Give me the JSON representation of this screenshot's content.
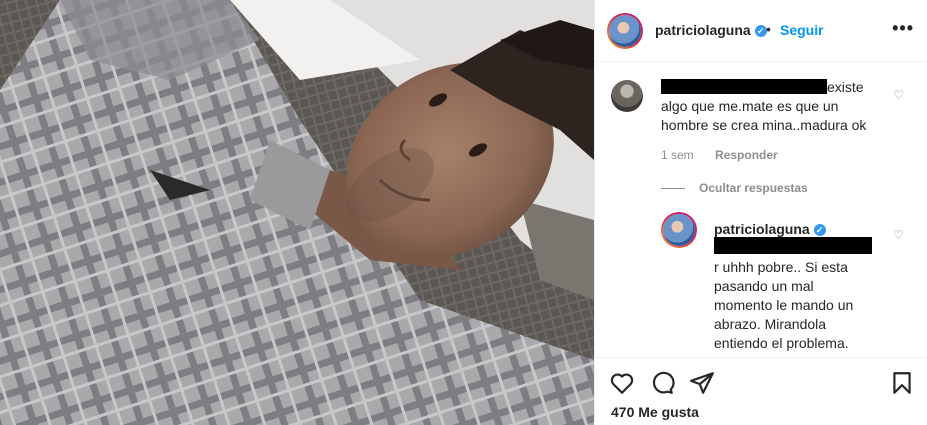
{
  "post": {
    "username": "patriciolaguna",
    "follow_label": "Seguir",
    "dot": "•",
    "more_label": "•••"
  },
  "comment": {
    "text_suffix": "existe algo que me.mate es que un hombre se crea mina..madura ok",
    "time": "1 sem",
    "reply_label": "Responder",
    "hide_replies_label": "Ocultar respuestas"
  },
  "reply": {
    "username": "patriciolaguna",
    "text": "r uhhh pobre.. Si esta pasando un mal momento le mando un abrazo. Mirandola entiendo el problema."
  },
  "actions": {
    "likes_label": "470 Me gusta"
  },
  "icons": {
    "verified": "verified-badge-icon",
    "heart": "heart-icon",
    "comment": "comment-icon",
    "share": "share-icon",
    "bookmark": "bookmark-icon"
  },
  "colors": {
    "link_blue": "#0095f6",
    "verified_blue": "#3897f0",
    "muted": "#8e8e8e"
  }
}
